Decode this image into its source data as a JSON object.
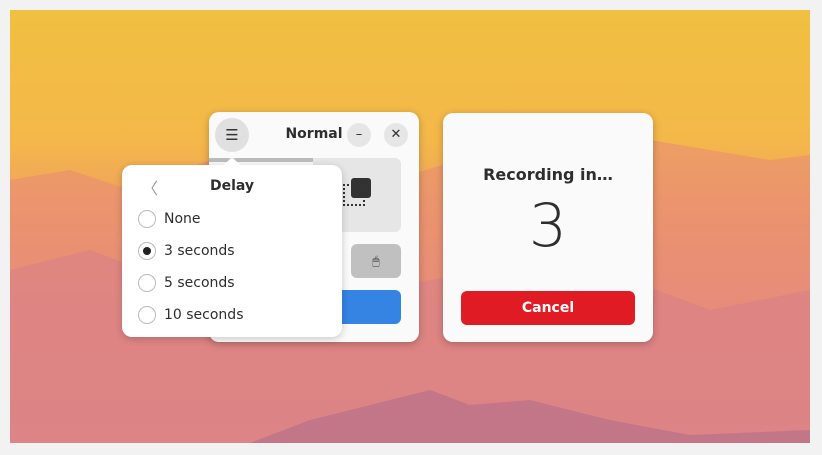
{
  "window": {
    "title": "Normal",
    "menu_icon": "☰",
    "minimize_icon": "–",
    "close_icon": "✕",
    "mouse_icon": "🖱"
  },
  "delay_popover": {
    "back_icon": "〈",
    "title": "Delay",
    "options": [
      {
        "label": "None",
        "selected": false
      },
      {
        "label": "3 seconds",
        "selected": true
      },
      {
        "label": "5 seconds",
        "selected": false
      },
      {
        "label": "10 seconds",
        "selected": false
      }
    ]
  },
  "recording": {
    "heading": "Recording in…",
    "countdown": "3",
    "cancel_label": "Cancel"
  }
}
